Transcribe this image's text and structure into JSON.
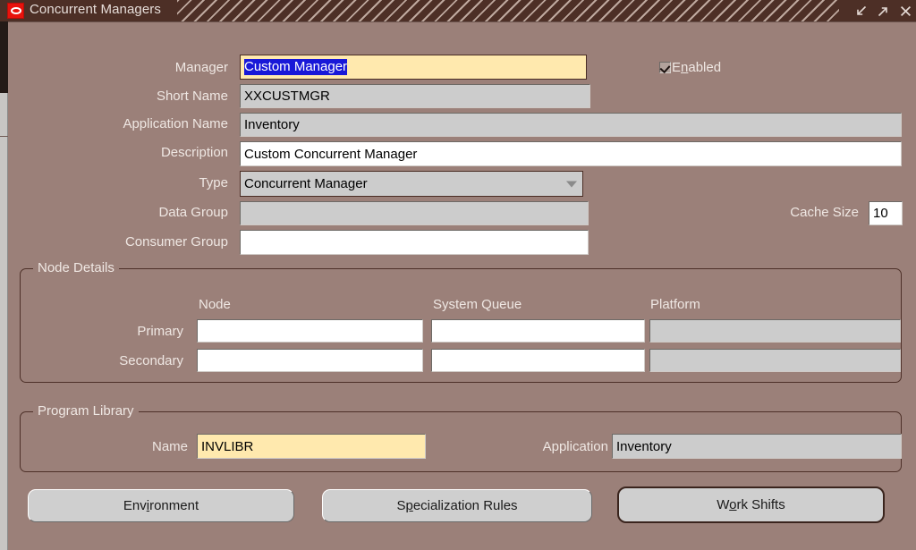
{
  "window": {
    "title": "Concurrent Managers",
    "app_icon": "oracle-logo-icon",
    "controls": [
      {
        "name": "minimize-button",
        "icon": "arrow-down-left-icon"
      },
      {
        "name": "maximize-button",
        "icon": "arrow-up-right-icon"
      },
      {
        "name": "close-button",
        "icon": "close-x-icon"
      }
    ]
  },
  "form": {
    "manager": {
      "label": "Manager",
      "value": "Custom Manager",
      "selected_text": "Custom Manager",
      "state": "required-focused"
    },
    "short_name": {
      "label": "Short Name",
      "value": "XXCUSTMGR",
      "state": "readonly"
    },
    "application_name": {
      "label": "Application Name",
      "value": "Inventory",
      "state": "readonly"
    },
    "description": {
      "label": "Description",
      "value": "Custom Concurrent Manager",
      "state": "editable"
    },
    "type": {
      "label": "Type",
      "value": "Concurrent Manager",
      "state": "dropdown",
      "icon": "chevron-down-icon"
    },
    "data_group": {
      "label": "Data Group",
      "value": "",
      "state": "readonly"
    },
    "consumer_group": {
      "label": "Consumer Group",
      "value": "",
      "state": "editable"
    },
    "enabled": {
      "label": "Enabled",
      "mnemonic_before": "E",
      "mnemonic": "n",
      "mnemonic_after": "abled",
      "checked": true
    },
    "cache_size": {
      "label": "Cache Size",
      "value": "10",
      "state": "editable"
    }
  },
  "node_details": {
    "title": "Node Details",
    "columns": [
      "Node",
      "System Queue",
      "Platform"
    ],
    "rows": [
      {
        "label": "Primary",
        "node": "",
        "system_queue": "",
        "platform": ""
      },
      {
        "label": "Secondary",
        "node": "",
        "system_queue": "",
        "platform": ""
      }
    ]
  },
  "program_library": {
    "title": "Program Library",
    "name": {
      "label": "Name",
      "value": "INVLIBR",
      "state": "required"
    },
    "application": {
      "label": "Application",
      "value": "Inventory",
      "state": "readonly"
    }
  },
  "buttons": [
    {
      "name": "environment-button",
      "label": "Environment",
      "mnemonic_before": "Env",
      "mnemonic": "i",
      "mnemonic_after": "ronment",
      "focused": false
    },
    {
      "name": "specialization-rules-button",
      "label": "Specialization Rules",
      "mnemonic_before": "S",
      "mnemonic": "p",
      "mnemonic_after": "ecialization Rules",
      "focused": false
    },
    {
      "name": "work-shifts-button",
      "label": "Work Shifts",
      "mnemonic_before": "W",
      "mnemonic": "o",
      "mnemonic_after": "rk Shifts",
      "focused": true
    }
  ],
  "colors": {
    "window_background": "#9b8079",
    "titlebar": "#4d2f26",
    "required_field": "#ffe9ae",
    "readonly_field": "#cccccc",
    "editable_field": "#ffffff",
    "selection": "#1818d8",
    "button_face": "#cfcfcf",
    "label_text": "#efe7e3"
  }
}
